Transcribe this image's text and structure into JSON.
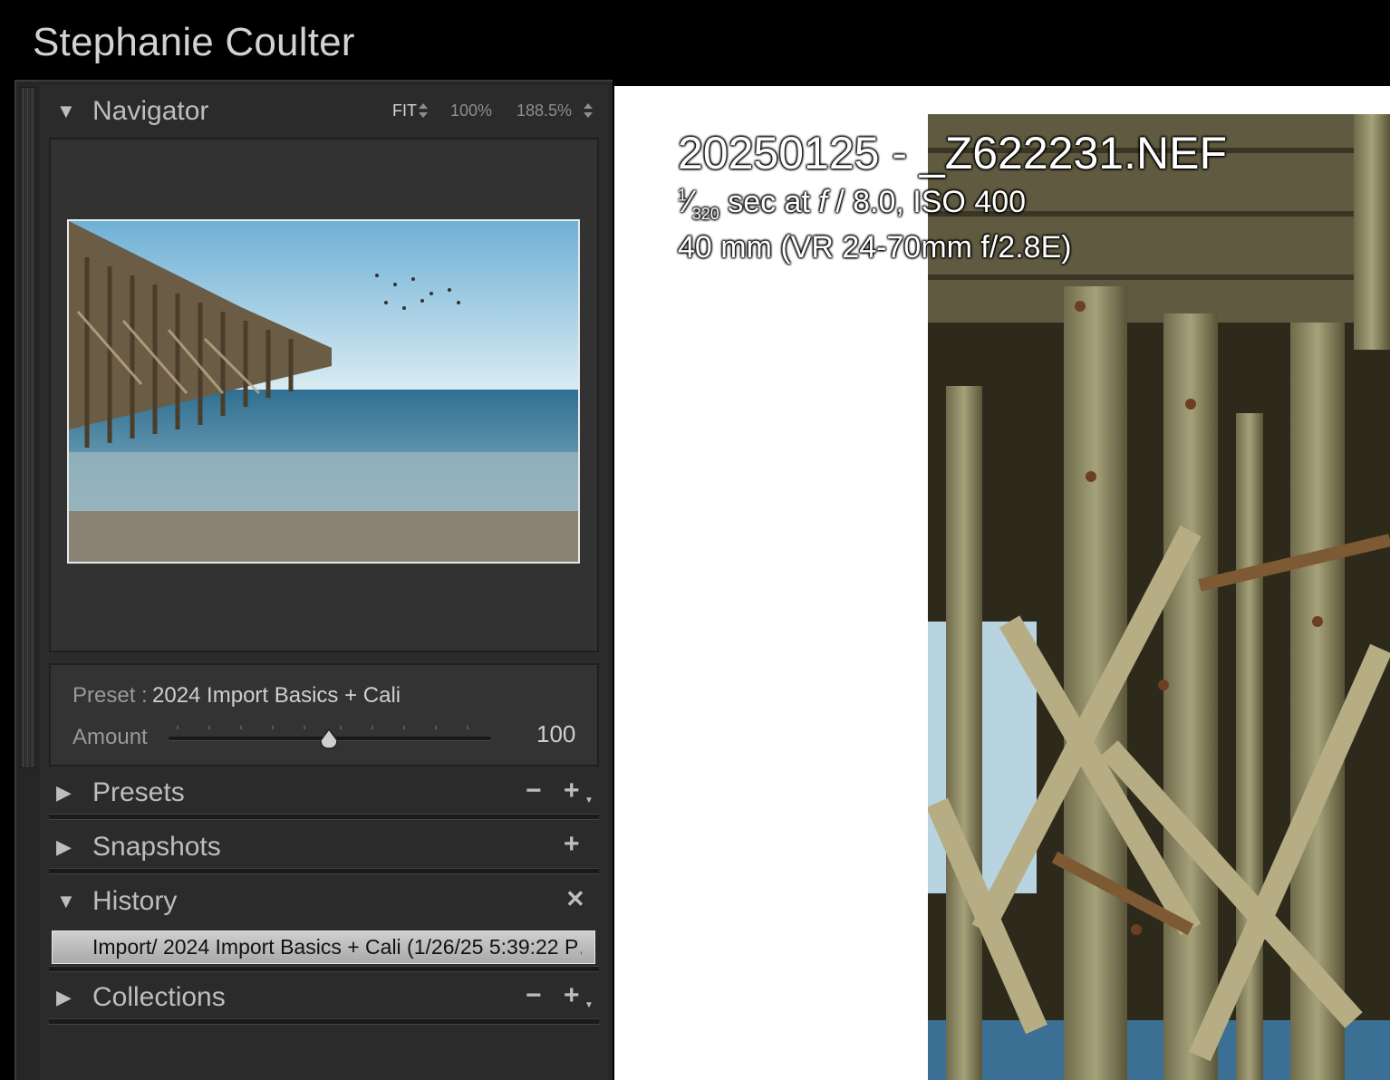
{
  "identity_plate": "Stephanie Coulter",
  "navigator": {
    "title": "Navigator",
    "zoom_fit": "FIT",
    "zoom_100": "100%",
    "zoom_custom": "188.5%"
  },
  "preset": {
    "label": "Preset :",
    "value": "2024 Import Basics + Cali",
    "amount_label": "Amount",
    "amount_value": "100",
    "amount_fraction": 0.5
  },
  "panels": {
    "presets": "Presets",
    "snapshots": "Snapshots",
    "history": "History",
    "collections": "Collections"
  },
  "history": {
    "items": [
      "Import/ 2024 Import Basics + Cali (1/26/25 5:39:22 P…"
    ]
  },
  "info_overlay": {
    "filename": "20250125 - _Z622231.NEF",
    "shutter_num": "1",
    "shutter_den": "320",
    "exposure_rest": " sec at ",
    "f_symbol": "f",
    "aperture_iso": " / 8.0, ISO 400",
    "lens": "40 mm (VR 24-70mm f/2.8E)"
  },
  "icons": {
    "expanded": "triangle-down-icon",
    "collapsed": "triangle-right-icon",
    "minus": "minus-icon",
    "plus": "plus-icon",
    "close": "close-icon"
  },
  "colors": {
    "panel_bg": "#2b2b2b",
    "selected_row": "#bdbdbd",
    "main_bg": "#ffffff"
  }
}
